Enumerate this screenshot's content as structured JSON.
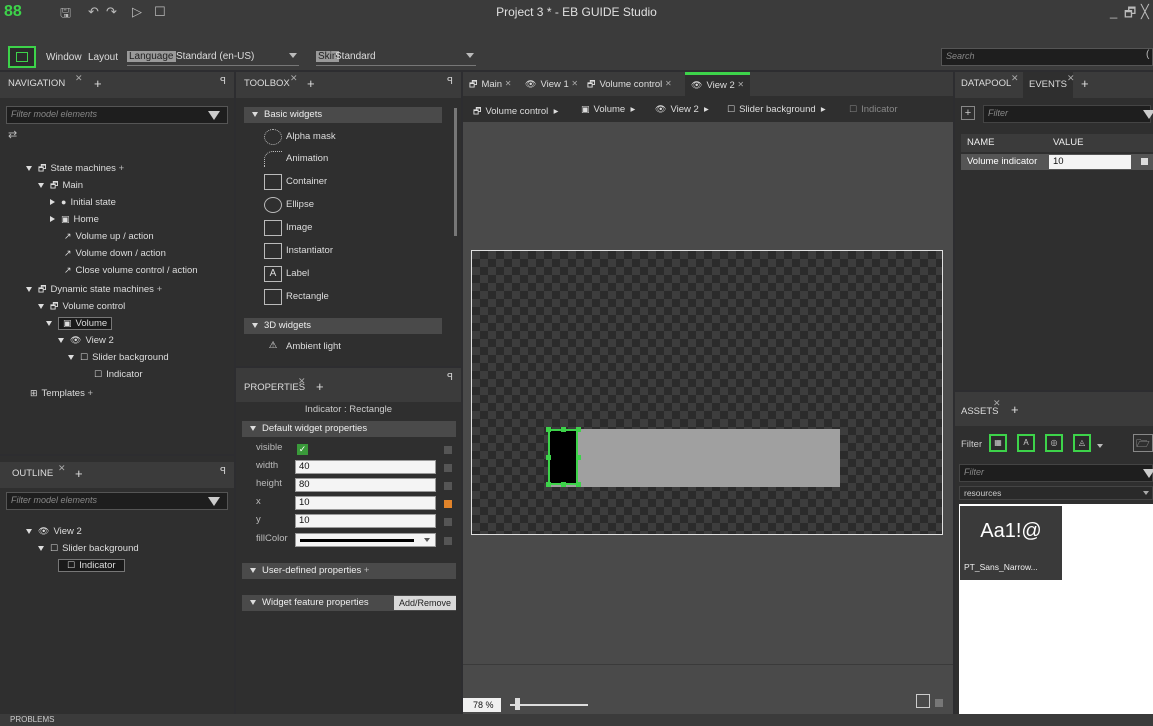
{
  "app": {
    "title": "Project 3 * - EB GUIDE Studio",
    "logo": "88",
    "minimize": "_",
    "restore": "🗗",
    "close": "╳"
  },
  "menu": {
    "window": "Window",
    "layout": "Layout",
    "language_label": "Language",
    "language_value": "Standard (en-US)",
    "skin_label": "Skin",
    "skin_value": "Standard",
    "search_placeholder": "Search",
    "search_trailing": "("
  },
  "navigation": {
    "tab": "NAVIGATION",
    "filter_placeholder": "Filter model elements",
    "swap_glyph": "⇄",
    "tree": [
      "State machines",
      "Main",
      "Initial state",
      "Home",
      "Volume up / action",
      "Volume down / action",
      "Close volume control / action",
      "Dynamic state machines",
      "Volume control",
      "Volume",
      "View 2",
      "Slider background",
      "Indicator",
      "Templates"
    ]
  },
  "outline": {
    "tab": "OUTLINE",
    "filter_placeholder": "Filter model elements",
    "tree": [
      "View 2",
      "Slider background",
      "Indicator"
    ]
  },
  "toolbox": {
    "tab": "TOOLBOX",
    "basic_header": "Basic widgets",
    "basic": [
      "Alpha mask",
      "Animation",
      "Container",
      "Ellipse",
      "Image",
      "Instantiator",
      "Label",
      "Rectangle"
    ],
    "threed_header": "3D widgets",
    "threed": [
      "Ambient light"
    ]
  },
  "properties": {
    "tab": "PROPERTIES",
    "subtitle": "Indicator : Rectangle",
    "default_header": "Default widget properties",
    "rows": [
      {
        "name": "visible",
        "value": ""
      },
      {
        "name": "width",
        "value": "40"
      },
      {
        "name": "height",
        "value": "80"
      },
      {
        "name": "x",
        "value": "10"
      },
      {
        "name": "y",
        "value": "10"
      },
      {
        "name": "fillColor",
        "value": ""
      }
    ],
    "user_header": "User-defined properties",
    "feature_header": "Widget feature properties",
    "add_remove": "Add/Remove"
  },
  "doc_tabs": [
    "Main",
    "View 1",
    "Volume control",
    "View 2"
  ],
  "breadcrumb": [
    "Volume control",
    "Volume",
    "View 2",
    "Slider background",
    "Indicator"
  ],
  "zoom": "78 %",
  "datapool": {
    "tab": "DATAPOOL",
    "tab2": "EVENTS",
    "filter_placeholder": "Filter",
    "col_name": "NAME",
    "col_value": "VALUE",
    "rows": [
      {
        "name": "Volume indicator",
        "value": "10"
      }
    ]
  },
  "assets": {
    "tab": "ASSETS",
    "filter_label": "Filter",
    "filter_placeholder": "Filter",
    "folder": "resources",
    "card_glyph": "Aa1!@",
    "card_name": "PT_Sans_Narrow..."
  },
  "status": {
    "problems": "PROBLEMS"
  },
  "colors": {
    "accent": "#3dd34a",
    "panel": "#2f2f2f",
    "titlebar": "#3b3b3b"
  }
}
